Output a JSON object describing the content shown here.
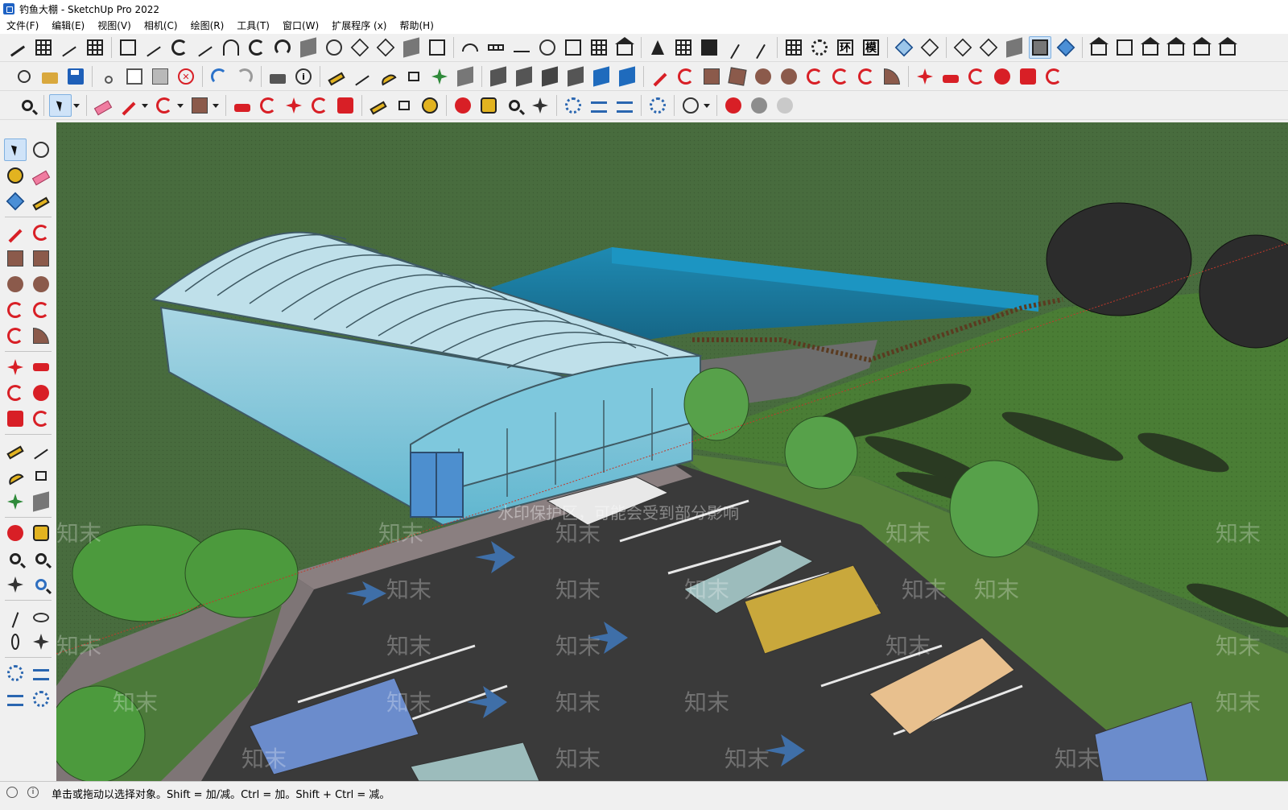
{
  "window": {
    "title": "钓鱼大棚 - SketchUp Pro 2022"
  },
  "menu": [
    {
      "label": "文件(F)"
    },
    {
      "label": "编辑(E)"
    },
    {
      "label": "视图(V)"
    },
    {
      "label": "相机(C)"
    },
    {
      "label": "绘图(R)"
    },
    {
      "label": "工具(T)"
    },
    {
      "label": "窗口(W)"
    },
    {
      "label": "扩展程序 (x)"
    },
    {
      "label": "帮助(H)"
    }
  ],
  "toolbar1": {
    "icons": [
      "stairs-icon",
      "column-icon",
      "ramp-icon",
      "bars-icon",
      "stair-tool-icon",
      "beam-icon",
      "curve-tool-icon",
      "skeleton-icon",
      "arch-icon",
      "spiral-icon",
      "spring-icon",
      "slab-icon",
      "knot-icon",
      "cube-net-icon",
      "cube-net-2-icon",
      "box-icon",
      "shadow-box-icon",
      "arc-wall-icon",
      "dots-icon",
      "wave-icon",
      "coil-icon",
      "pen-book-icon",
      "hand-icon",
      "pavilion-icon",
      "symmetry-icon",
      "dot-grid-icon",
      "book-icon",
      "pin-tool-icon",
      "brush-icon"
    ],
    "panel_text": [
      "环",
      "模"
    ],
    "style_icons": [
      "xray-cube-icon",
      "wire-cube-icon",
      "hidden-line-icon",
      "shaded-icon",
      "textured-icon",
      "monochrome-icon",
      "style-icon"
    ],
    "view_icons": [
      "iso-view-icon",
      "top-view-icon",
      "front-view-icon",
      "right-view-icon",
      "back-view-icon",
      "left-view-icon"
    ]
  },
  "toolbar2": {
    "icons": [
      "new-icon",
      "open-icon",
      "save-icon",
      "cut-icon",
      "copy-icon",
      "paste-icon",
      "erase-icon",
      "undo-icon",
      "redo-icon",
      "print-icon",
      "model-info-icon",
      "tape-measure-icon",
      "dimension-icon",
      "protractor-icon",
      "text-icon",
      "axes-icon",
      "3d-text-icon",
      "outer-shell-icon",
      "intersect-icon",
      "union-icon",
      "subtract-icon",
      "trim-icon",
      "split-icon",
      "line-icon",
      "freehand-icon",
      "rectangle-icon",
      "rotated-rect-icon",
      "circle-icon",
      "polygon-icon",
      "arc-icon",
      "2pt-arc-icon",
      "3pt-arc-icon",
      "pie-icon",
      "move-icon",
      "push-pull-icon",
      "rotate-icon",
      "follow-me-icon",
      "scale-icon",
      "offset-icon"
    ]
  },
  "toolbar3": {
    "icons": [
      "zoom-icon",
      "select-icon",
      "eraser-icon",
      "pencil-icon",
      "arc-draw-icon",
      "shape-icon",
      "push-pull-icon",
      "offset-icon",
      "move-icon",
      "rotate-icon",
      "scale-icon",
      "tape-icon",
      "text-icon",
      "paint-bucket-icon",
      "orbit-icon",
      "pan-icon",
      "zoom-window-icon",
      "zoom-extents-icon",
      "component-icon",
      "sandbox-icon",
      "layers-icon",
      "settings-icon",
      "user-icon",
      "trimble-icon",
      "3d-warehouse-icon",
      "extension-icon"
    ]
  },
  "left_toolbar": {
    "icons": [
      "select-icon",
      "orbit-icon",
      "paint-bucket-icon",
      "eraser-icon",
      "component-icon",
      "pencil-pick-icon",
      "line-icon",
      "freehand-icon",
      "rectangle-icon",
      "rotated-rect-icon",
      "circle-icon",
      "polygon-icon",
      "arc-icon",
      "2pt-arc-icon",
      "3pt-arc-icon",
      "pie-icon",
      "move-icon",
      "push-pull-icon",
      "rotate-icon",
      "follow-me-icon",
      "scale-icon",
      "offset-icon",
      "tape-icon",
      "dimension-icon",
      "axes-icon",
      "3d-text-icon",
      "orbit-2-icon",
      "pan-icon",
      "zoom-icon",
      "zoom-window-icon",
      "zoom-extents-icon",
      "previous-icon",
      "position-camera-icon",
      "look-around-icon",
      "walk-icon",
      "section-icon",
      "component-2-icon",
      "sandbox-icon",
      "layers-icon",
      "settings-icon"
    ]
  },
  "viewport": {
    "watermarks": [
      "知末",
      "知末",
      "知末",
      "知末",
      "知末",
      "知末",
      "知末",
      "知末",
      "知末",
      "知末",
      "知末",
      "知末",
      "知末",
      "知末",
      "知末",
      "知末",
      "知末",
      "知末",
      "知末",
      "知末",
      "知末",
      "知末",
      "知末",
      "知末"
    ],
    "watermark_banner": "水印保护区，可能会受到部分影响",
    "colors": {
      "sky_ground": "#486c3e",
      "lawn": "#4a7d35",
      "parking": "#3a3a3a",
      "pool_water": "#1e7fa8",
      "greenhouse_glass": "#7fc0d8"
    }
  },
  "status": {
    "text": "单击或拖动以选择对象。Shift = 加/减。Ctrl = 加。Shift + Ctrl = 减。"
  }
}
